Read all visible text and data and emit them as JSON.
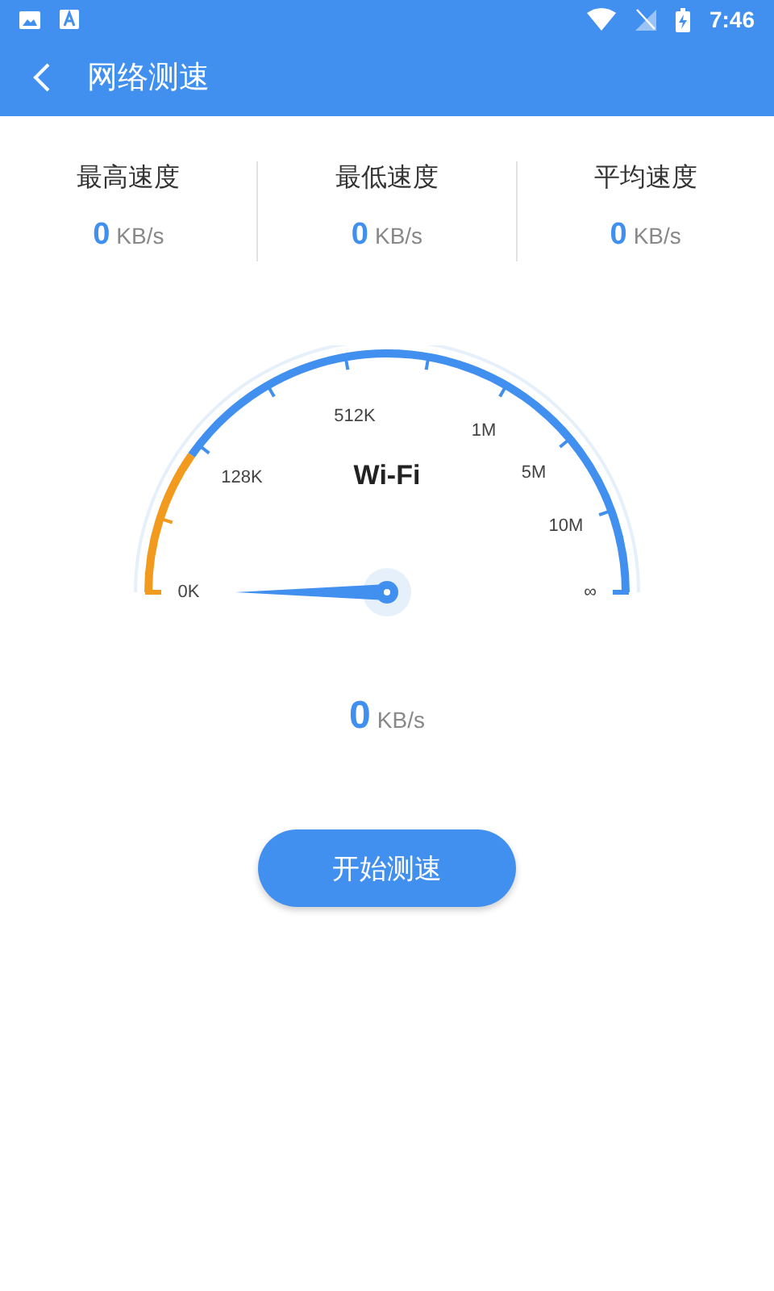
{
  "status_bar": {
    "time": "7:46"
  },
  "header": {
    "title": "网络测速"
  },
  "stats": [
    {
      "label": "最高速度",
      "value": "0",
      "unit": "KB/s"
    },
    {
      "label": "最低速度",
      "value": "0",
      "unit": "KB/s"
    },
    {
      "label": "平均速度",
      "value": "0",
      "unit": "KB/s"
    }
  ],
  "gauge": {
    "network": "Wi-Fi",
    "scale": [
      "0K",
      "128K",
      "512K",
      "1M",
      "5M",
      "10M",
      "∞"
    ]
  },
  "current": {
    "value": "0",
    "unit": "KB/s"
  },
  "start_button": {
    "label": "开始测速"
  }
}
